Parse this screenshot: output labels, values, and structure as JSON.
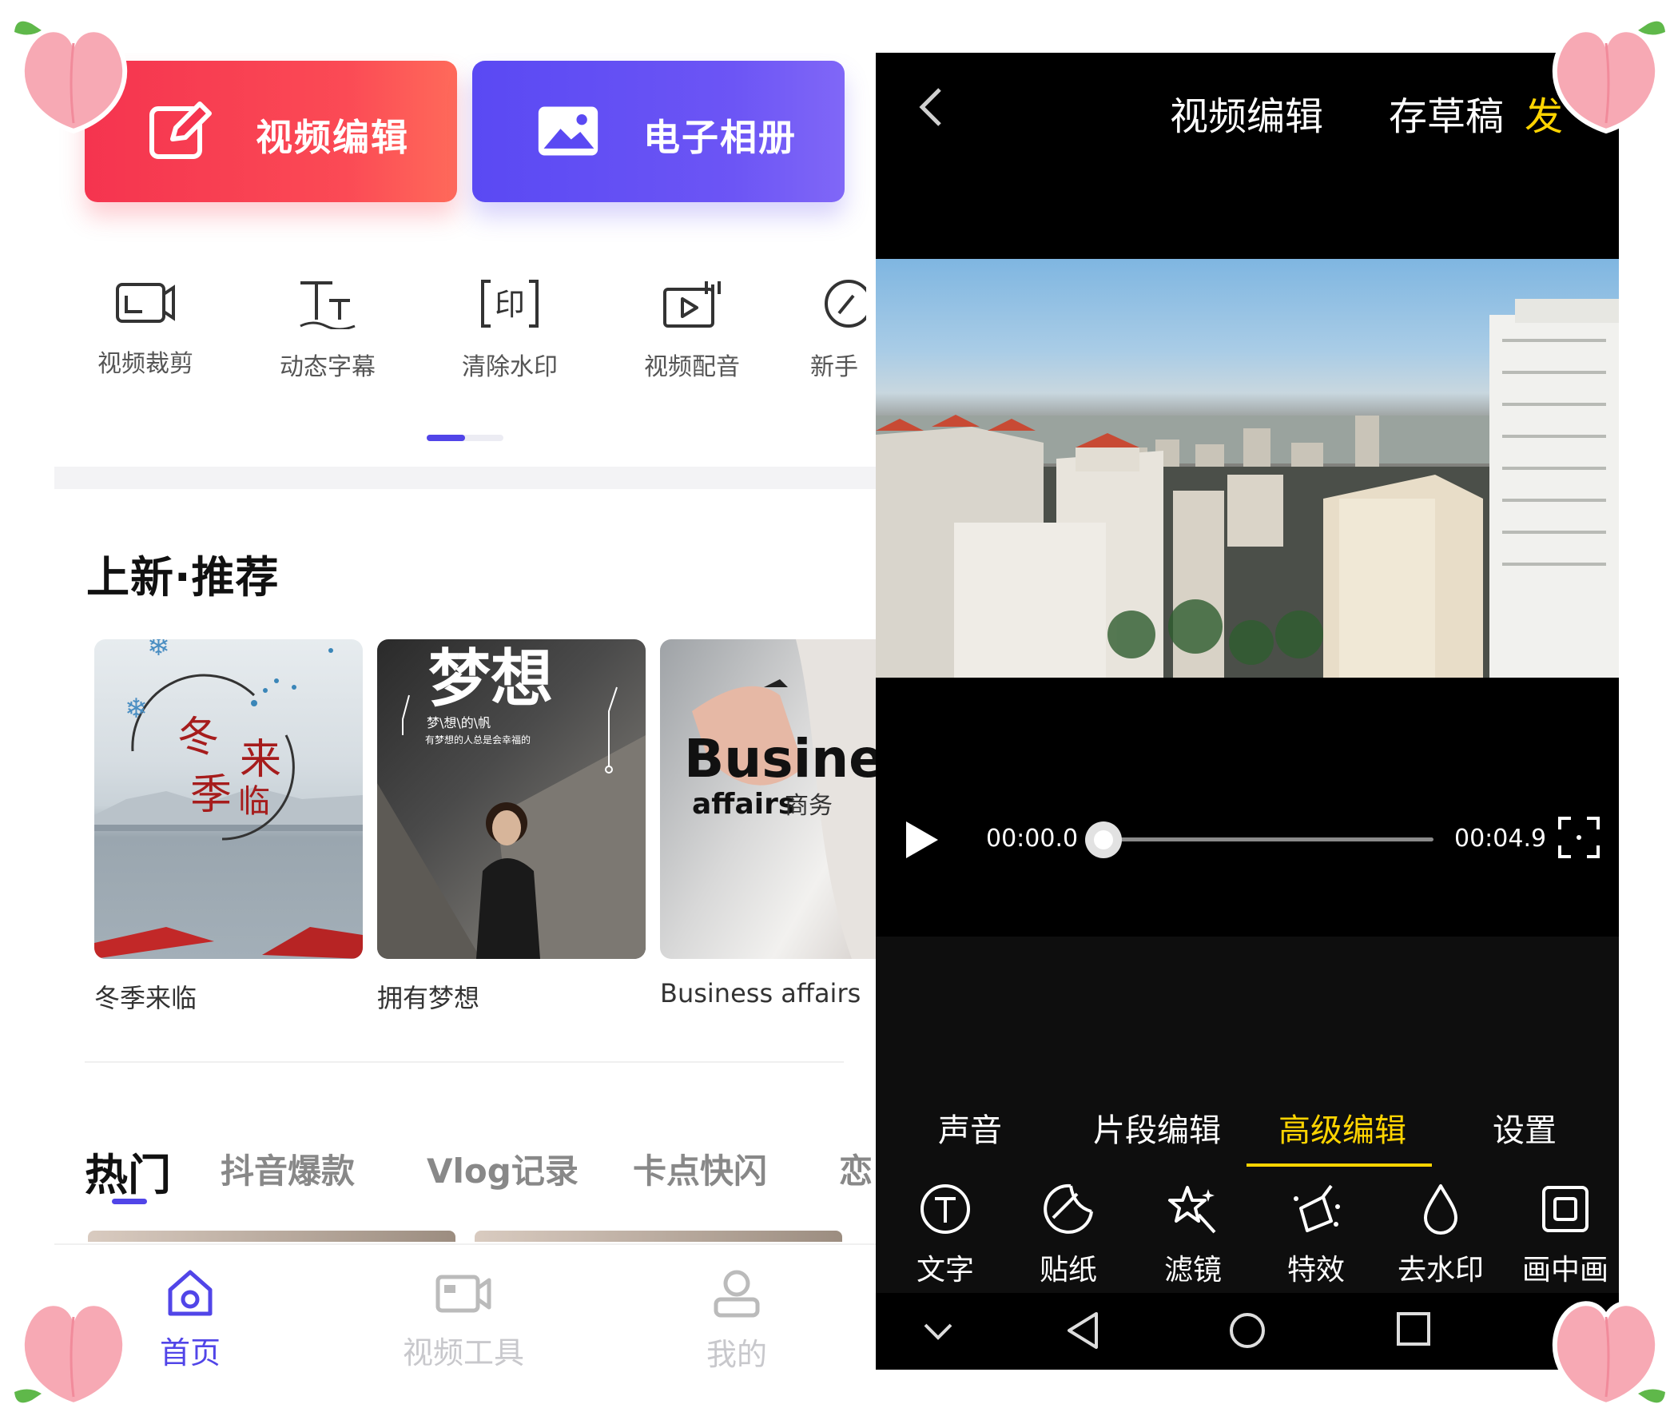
{
  "home": {
    "top_buttons": {
      "video_edit": "视频编辑",
      "photo_album": "电子相册"
    },
    "tools": [
      {
        "label": "视频裁剪",
        "icon": "crop-icon"
      },
      {
        "label": "动态字幕",
        "icon": "subtitle-icon"
      },
      {
        "label": "清除水印",
        "icon": "watermark-icon"
      },
      {
        "label": "视频配音",
        "icon": "dubbing-icon"
      },
      {
        "label": "新手",
        "icon": "guide-icon"
      }
    ],
    "section_title": "上新·推荐",
    "recommended": [
      {
        "caption": "冬季来临",
        "thumb_lines": [
          "冬",
          "来",
          "季",
          "临"
        ]
      },
      {
        "caption": "拥有梦想",
        "thumb_title": "梦想",
        "thumb_sub": "梦\\想\\的\\帆",
        "thumb_line": "有梦想的人总是会幸福的"
      },
      {
        "caption": "Business affairs",
        "thumb_title": "Busines",
        "thumb_sub": "affairs",
        "thumb_cn": "商务"
      }
    ],
    "hot_tabs": [
      "热门",
      "抖音爆款",
      "Vlog记录",
      "卡点快闪",
      "恋"
    ],
    "bottom_nav": {
      "home": "首页",
      "video_tools": "视频工具",
      "mine": "我的"
    },
    "accent_color": "#5145e8"
  },
  "editor": {
    "title": "视频编辑",
    "save_draft": "存草稿",
    "publish": "发",
    "time_start": "00:00.0",
    "time_end": "00:04.9",
    "progress": 0,
    "tabs": [
      "声音",
      "片段编辑",
      "高级编辑",
      "设置"
    ],
    "active_tab": "高级编辑",
    "tools": [
      {
        "label": "文字",
        "icon": "text-icon"
      },
      {
        "label": "贴纸",
        "icon": "sticker-icon"
      },
      {
        "label": "滤镜",
        "icon": "filter-icon"
      },
      {
        "label": "特效",
        "icon": "effects-icon"
      },
      {
        "label": "去水印",
        "icon": "remove-watermark-icon"
      },
      {
        "label": "画中画",
        "icon": "pip-icon"
      }
    ],
    "highlight_color": "#ffd400"
  }
}
